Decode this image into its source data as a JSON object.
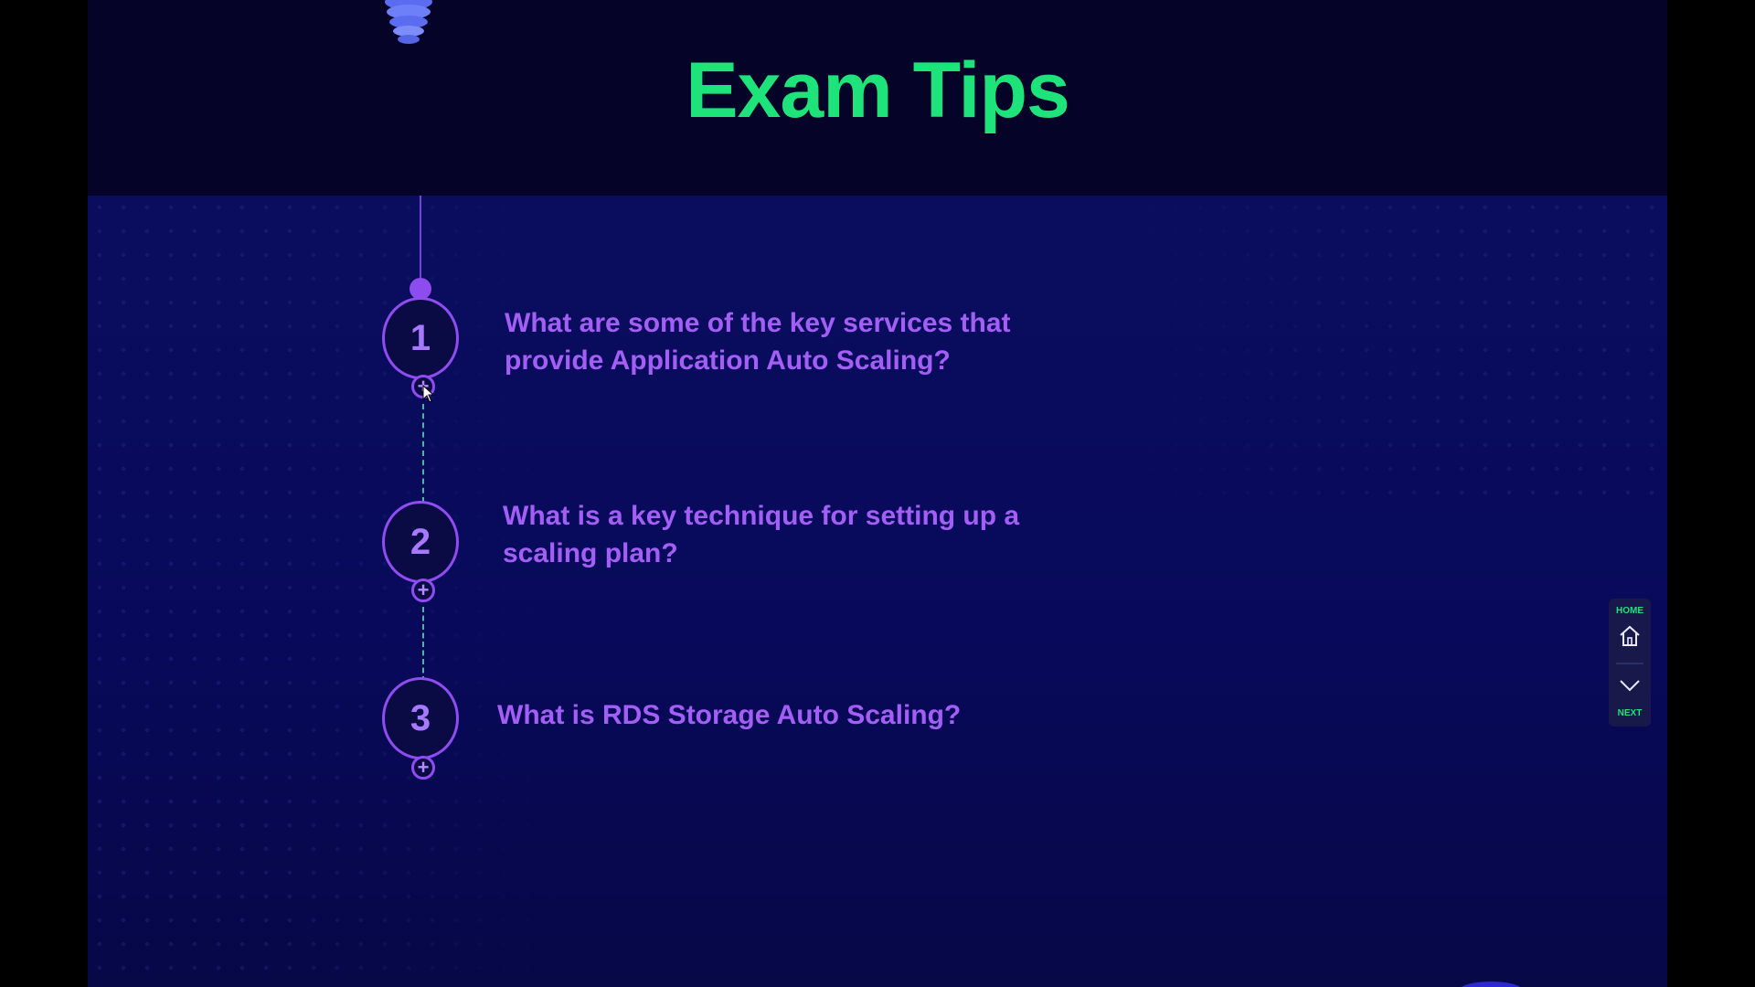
{
  "slide": {
    "title": "Exam Tips"
  },
  "tips": [
    {
      "number": "1",
      "question": "What are some of the key services that provide Application Auto Scaling?"
    },
    {
      "number": "2",
      "question": "What is a key technique for setting up a scaling plan?"
    },
    {
      "number": "3",
      "question": "What is RDS Storage Auto Scaling?"
    }
  ],
  "nav": {
    "home_label": "HOME",
    "next_label": "NEXT",
    "home_icon": "home-icon",
    "next_icon": "chevron-down-icon"
  },
  "colors": {
    "title": "#1ee27a",
    "question": "#a35ff5",
    "circle_border": "#8f4cf0",
    "background": "#050327"
  }
}
